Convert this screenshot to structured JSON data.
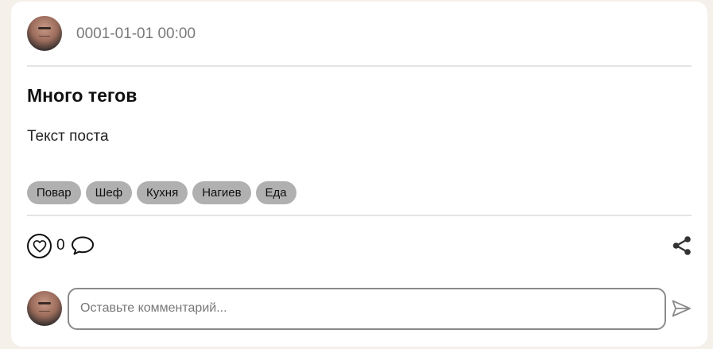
{
  "post": {
    "date": "0001-01-01 00:00",
    "title": "Много тегов",
    "text": "Текст поста",
    "tags": [
      "Повар",
      "Шеф",
      "Кухня",
      "Нагиев",
      "Еда"
    ],
    "likes": "0"
  },
  "comment": {
    "placeholder": "Оставьте комментарий..."
  },
  "icons": {
    "like": "heart-icon",
    "comment": "speech-bubble-icon",
    "share": "share-icon",
    "send": "send-icon"
  },
  "colors": {
    "background": "#f5f0ea",
    "card": "#ffffff",
    "tag": "#b0b0b0",
    "date": "#7a7a7a"
  }
}
